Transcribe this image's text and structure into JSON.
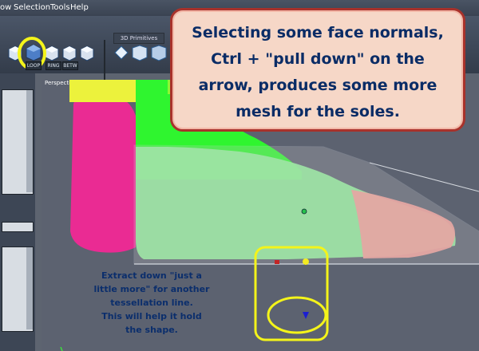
{
  "menubar": {
    "items": [
      "ow",
      "Selection",
      "Tools",
      "Help"
    ]
  },
  "toolbar": {
    "primitives_tab": "3D Primitives",
    "chips": [
      "LOOP",
      "RING",
      "BETW"
    ]
  },
  "viewport": {
    "label": "Perspective view"
  },
  "callout": {
    "lines": [
      "Selecting some face normals,",
      "Ctrl + \"pull down\" on the",
      "arrow, produces some more",
      "mesh for the soles."
    ]
  },
  "note": {
    "lines": [
      "Extract down \"just a",
      "little more\" for another",
      "tessellation line.",
      "This will help it hold",
      "the shape."
    ]
  },
  "colors": {
    "callout_border": "#a8322b",
    "callout_fill": "#f6d7c7",
    "callout_text": "#0a2c66",
    "highlight": "#f4f41a",
    "leg_pink": "#ea2b93",
    "leg_green": "#2ff52f",
    "leg_yellow": "#ecf23c",
    "foot_green": "#91ed9a",
    "foot_skin": "#ef9b97"
  },
  "icons": [
    "cube-select-icon",
    "cube-icon",
    "cube-grid-icon",
    "arrow-handle-icon",
    "vertex-handle-icon"
  ]
}
